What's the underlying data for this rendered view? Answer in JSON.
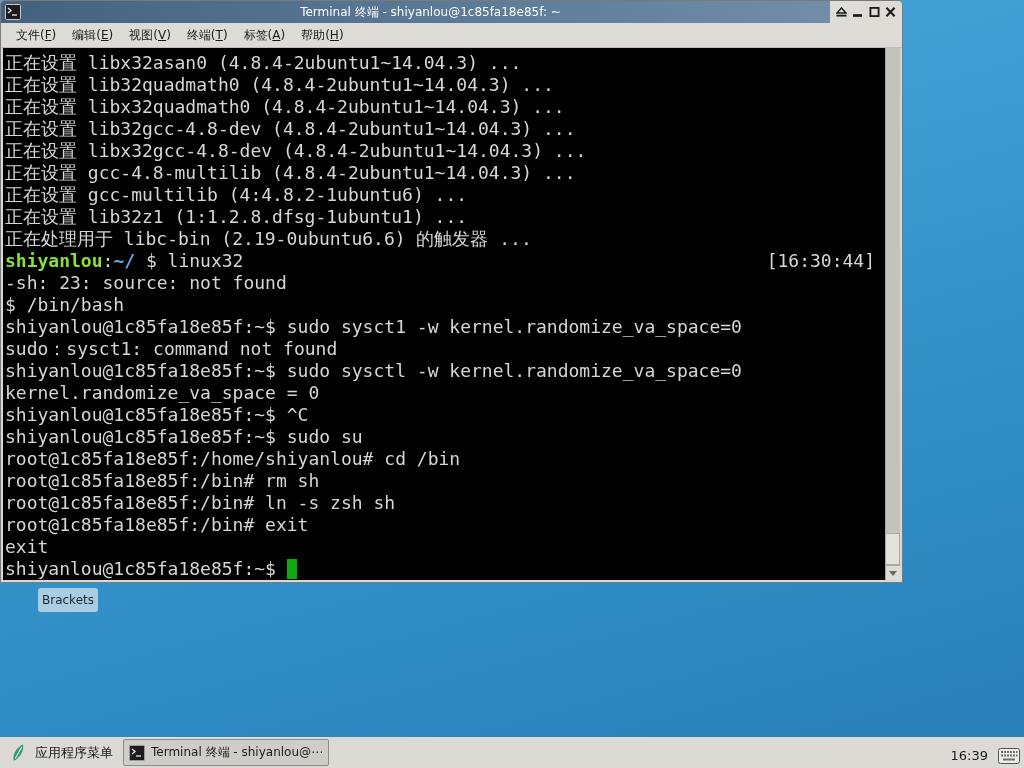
{
  "window": {
    "title": "Terminal 终端 - shiyanlou@1c85fa18e85f: ~",
    "menu": [
      {
        "before": "文件(",
        "key": "F",
        "after": ")"
      },
      {
        "before": "编辑(",
        "key": "E",
        "after": ")"
      },
      {
        "before": "视图(",
        "key": "V",
        "after": ")"
      },
      {
        "before": "终端(",
        "key": "T",
        "after": ")"
      },
      {
        "before": "标签(",
        "key": "A",
        "after": ")"
      },
      {
        "before": "帮助(",
        "key": "H",
        "after": ")"
      }
    ],
    "terminal": {
      "lines": [
        {
          "kind": "text",
          "text": "正在设置 libx32asan0 (4.8.4-2ubuntu1~14.04.3) ..."
        },
        {
          "kind": "text",
          "text": "正在设置 lib32quadmath0 (4.8.4-2ubuntu1~14.04.3) ..."
        },
        {
          "kind": "text",
          "text": "正在设置 libx32quadmath0 (4.8.4-2ubuntu1~14.04.3) ..."
        },
        {
          "kind": "text",
          "text": "正在设置 lib32gcc-4.8-dev (4.8.4-2ubuntu1~14.04.3) ..."
        },
        {
          "kind": "text",
          "text": "正在设置 libx32gcc-4.8-dev (4.8.4-2ubuntu1~14.04.3) ..."
        },
        {
          "kind": "text",
          "text": "正在设置 gcc-4.8-multilib (4.8.4-2ubuntu1~14.04.3) ..."
        },
        {
          "kind": "text",
          "text": "正在设置 gcc-multilib (4:4.8.2-1ubuntu6) ..."
        },
        {
          "kind": "text",
          "text": "正在设置 lib32z1 (1:1.2.8.dfsg-1ubuntu1) ..."
        },
        {
          "kind": "text",
          "text": "正在处理用于 libc-bin (2.19-0ubuntu6.6) 的触发器 ..."
        },
        {
          "kind": "prompt",
          "user": "shiyanlou",
          "colon": ":",
          "path": "~/",
          "command": " $ linux32",
          "time": "[16:30:44]"
        },
        {
          "kind": "text",
          "text": "-sh: 23: source: not found"
        },
        {
          "kind": "text",
          "text": "$ /bin/bash"
        },
        {
          "kind": "text",
          "text": "shiyanlou@1c85fa18e85f:~$ sudo sysct1 -w kernel.randomize_va_space=0"
        },
        {
          "kind": "text",
          "text": "sudo：sysct1: command not found"
        },
        {
          "kind": "text",
          "text": "shiyanlou@1c85fa18e85f:~$ sudo sysctl -w kernel.randomize_va_space=0"
        },
        {
          "kind": "text",
          "text": "kernel.randomize_va_space = 0"
        },
        {
          "kind": "text",
          "text": "shiyanlou@1c85fa18e85f:~$ ^C"
        },
        {
          "kind": "text",
          "text": "shiyanlou@1c85fa18e85f:~$ sudo su"
        },
        {
          "kind": "text",
          "text": "root@1c85fa18e85f:/home/shiyanlou# cd /bin"
        },
        {
          "kind": "text",
          "text": "root@1c85fa18e85f:/bin# rm sh"
        },
        {
          "kind": "text",
          "text": "root@1c85fa18e85f:/bin# ln -s zsh sh"
        },
        {
          "kind": "text",
          "text": "root@1c85fa18e85f:/bin# exit"
        },
        {
          "kind": "text",
          "text": "exit"
        },
        {
          "kind": "input",
          "text": "shiyanlou@1c85fa18e85f:~$",
          "cursor": true
        }
      ]
    }
  },
  "desktop_icons": [
    {
      "label": "Brackets",
      "selected": true
    }
  ],
  "taskbar": {
    "app_menu": "应用程序菜单",
    "tasks": [
      {
        "label": "Terminal 终端 - shiyanlou@⋯",
        "selected": true
      }
    ],
    "clock": "16:39"
  }
}
